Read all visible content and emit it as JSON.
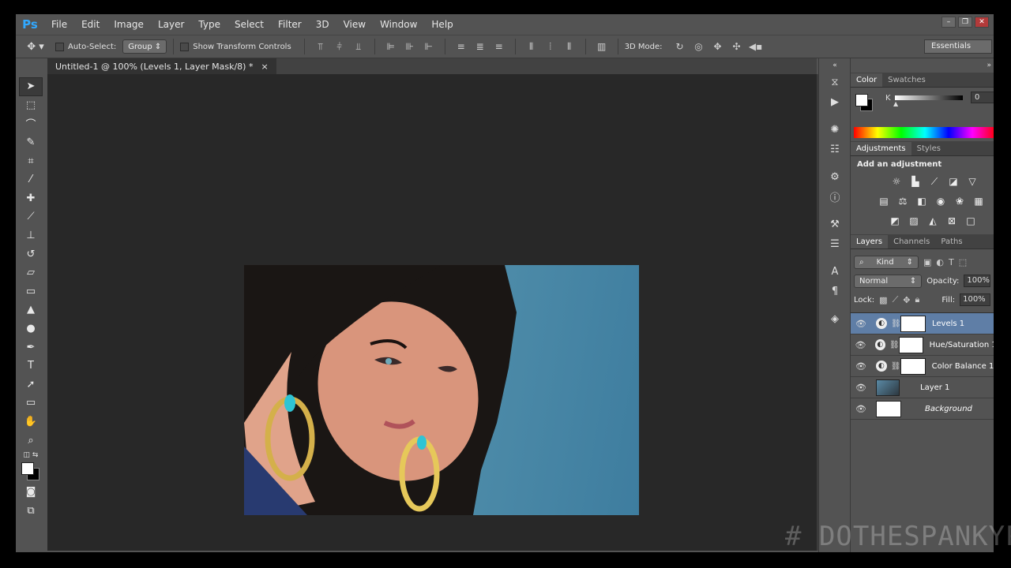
{
  "app": {
    "logo": "Ps"
  },
  "menu": [
    "File",
    "Edit",
    "Image",
    "Layer",
    "Type",
    "Select",
    "Filter",
    "3D",
    "View",
    "Window",
    "Help"
  ],
  "options": {
    "auto_select_label": "Auto-Select:",
    "auto_select_value": "Group",
    "transform_label": "Show Transform Controls",
    "mode3d_label": "3D Mode:",
    "workspace": "Essentials"
  },
  "document": {
    "tab_title": "Untitled-1 @ 100% (Levels 1, Layer Mask/8) *"
  },
  "color_panel": {
    "tabs": [
      "Color",
      "Swatches"
    ],
    "channel_label": "K",
    "channel_value": "0"
  },
  "adjustments_panel": {
    "tabs": [
      "Adjustments",
      "Styles"
    ],
    "title": "Add an adjustment"
  },
  "layers_panel": {
    "tabs": [
      "Layers",
      "Channels",
      "Paths"
    ],
    "filter_kind": "Kind",
    "blend_mode": "Normal",
    "opacity_label": "Opacity:",
    "opacity_value": "100%",
    "lock_label": "Lock:",
    "fill_label": "Fill:",
    "fill_value": "100%",
    "layers": [
      {
        "name": "Levels 1",
        "selected": true
      },
      {
        "name": "Hue/Saturation 1"
      },
      {
        "name": "Color Balance 1"
      },
      {
        "name": "Layer 1"
      },
      {
        "name": "Background"
      }
    ]
  },
  "watermark": "# DOTHESPANKYPANKY"
}
